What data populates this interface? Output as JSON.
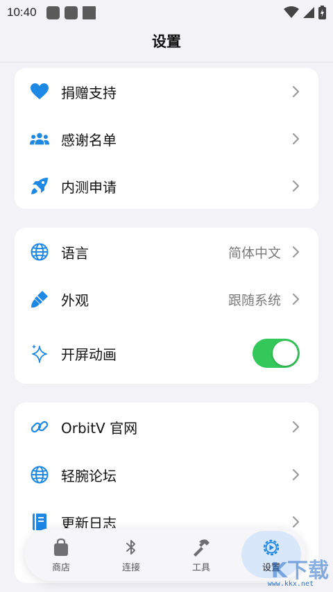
{
  "status_bar": {
    "time": "10:40"
  },
  "header": {
    "title": "设置"
  },
  "section1": [
    {
      "label": "捐赠支持",
      "icon": "heart-icon"
    },
    {
      "label": "感谢名单",
      "icon": "people-icon"
    },
    {
      "label": "内测申请",
      "icon": "rocket-icon"
    }
  ],
  "section2": [
    {
      "label": "语言",
      "value": "简体中文",
      "icon": "globe-icon"
    },
    {
      "label": "外观",
      "value": "跟随系统",
      "icon": "paintbrush-icon"
    },
    {
      "label": "开屏动画",
      "icon": "sparkles-icon",
      "toggle_on": true
    }
  ],
  "section3": [
    {
      "label": "OrbitV 官网",
      "icon": "link-icon"
    },
    {
      "label": "轻腕论坛",
      "icon": "globe-icon"
    },
    {
      "label": "更新日志",
      "icon": "book-icon"
    }
  ],
  "tabbar": {
    "tabs": [
      {
        "label": "商店",
        "icon": "bag-icon"
      },
      {
        "label": "连接",
        "icon": "bluetooth-icon"
      },
      {
        "label": "工具",
        "icon": "hammer-icon"
      },
      {
        "label": "设置",
        "icon": "gear-play-icon",
        "active": true
      }
    ]
  },
  "watermark": {
    "text": "www.kkx.net",
    "big": "K下载"
  },
  "colors": {
    "accent": "#1e88e5",
    "toggle_on": "#34c759",
    "background": "#f2f2f7"
  }
}
